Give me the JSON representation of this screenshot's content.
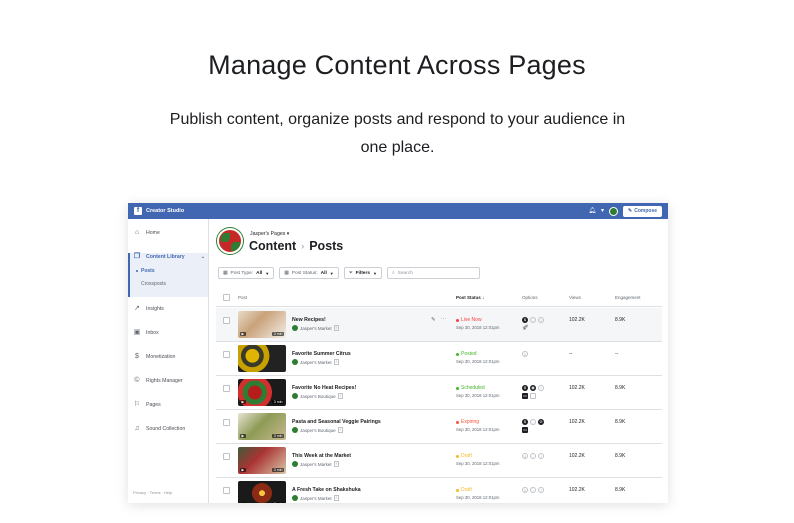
{
  "hero": {
    "title": "Manage Content Across Pages",
    "subtitle_line1": "Publish content, organize posts and respond to your audience in",
    "subtitle_line2": "one place."
  },
  "topbar": {
    "logo": "f",
    "app_name": "Creator Studio",
    "icons": [
      "bell-icon",
      "caret-down-icon",
      "avatar"
    ],
    "compose_label": "Compose"
  },
  "sidebar": {
    "items": [
      {
        "label": "Home",
        "icon": "home-icon"
      },
      {
        "label": "Content Library",
        "icon": "library-icon"
      },
      {
        "label": "Insights",
        "icon": "insights-icon"
      },
      {
        "label": "Inbox",
        "icon": "inbox-icon"
      },
      {
        "label": "Monetization",
        "icon": "dollar-icon"
      },
      {
        "label": "Rights Manager",
        "icon": "copyright-icon"
      },
      {
        "label": "Pages",
        "icon": "flag-icon"
      },
      {
        "label": "Sound Collection",
        "icon": "music-icon"
      }
    ],
    "sub_items": [
      "Posts",
      "Crossposts"
    ],
    "footer": "Privacy · Terms · Help"
  },
  "header": {
    "pages_label": "Jasper's Pages ▾",
    "crumb_1": "Content",
    "crumb_2": "Posts"
  },
  "filters": {
    "post_type_label": "Post Type:",
    "post_type_value": "All",
    "post_status_label": "Post Status:",
    "post_status_value": "All",
    "filters_label": "Filters",
    "search_placeholder": "Search"
  },
  "table": {
    "columns": {
      "post": "Post",
      "status": "Post Status ↓",
      "options": "Options",
      "views": "Views",
      "engagement": "Engagement"
    },
    "rows": [
      {
        "title": "New Recipes!",
        "page": "Jasper's Market",
        "status": "Live Now",
        "status_color": "#fa3e3e",
        "date": "Sep 30, 2018 12:01pm",
        "views": "102.2K",
        "engagement": "8.9K",
        "duration": "3 min"
      },
      {
        "title": "Favorite Summer Citrus",
        "page": "Jasper's Market",
        "status": "Posted",
        "status_color": "#42b72a",
        "date": "Sep 30, 2018 12:01pm",
        "views": "--",
        "engagement": "--",
        "duration": ""
      },
      {
        "title": "Favorite No Heat Recipes!",
        "page": "Jasper's Boutique",
        "status": "Scheduled",
        "status_color": "#42b72a",
        "date": "Sep 30, 2018 12:01pm",
        "views": "102.2K",
        "engagement": "8.9K",
        "duration": "3 min"
      },
      {
        "title": "Pasta and Seasonal Veggie Pairings",
        "page": "Jasper's Boutique",
        "status": "Expiring",
        "status_color": "#f5533d",
        "date": "Sep 30, 2018 12:01pm",
        "views": "102.2K",
        "engagement": "8.9K",
        "duration": "3 min"
      },
      {
        "title": "This Week at the Market",
        "page": "Jasper's Market",
        "status": "Draft",
        "status_color": "#f7b928",
        "date": "Sep 30, 2018 12:01pm",
        "views": "102.2K",
        "engagement": "8.9K",
        "duration": "3 min"
      },
      {
        "title": "A Fresh Take on Shakshuka",
        "page": "Jasper's Market",
        "status": "Draft",
        "status_color": "#f7b928",
        "date": "Sep 30, 2018 12:01pm",
        "views": "102.2K",
        "engagement": "8.9K",
        "duration": "3 min"
      }
    ]
  },
  "colors": {
    "brand": "#4267b2",
    "text": "#1c1e21",
    "muted": "#606770"
  }
}
